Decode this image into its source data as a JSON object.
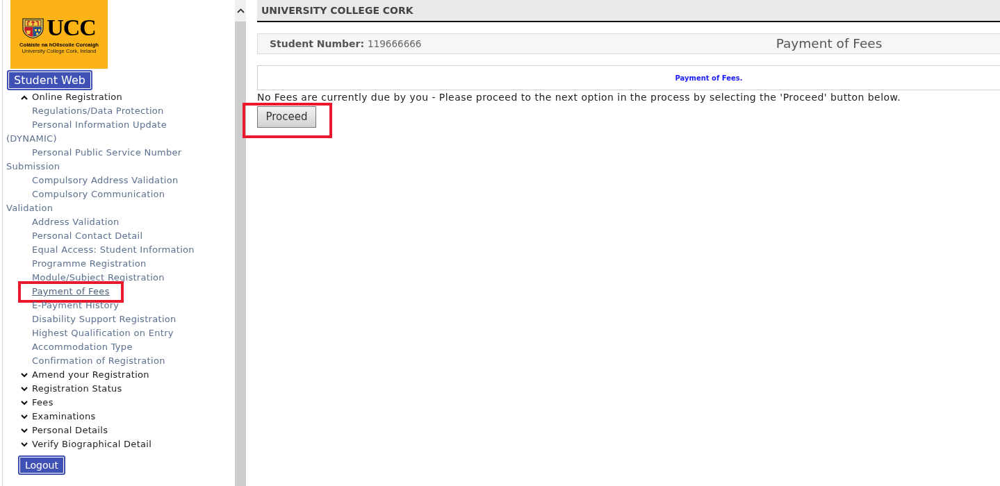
{
  "logo": {
    "name": "UCC",
    "irish_name": "Coláiste na hOllscoile Corcaigh",
    "english_name": "University College Cork, Ireland"
  },
  "sidebar": {
    "title_button": "Student Web",
    "menu": [
      {
        "label": "Online Registration",
        "expanded": true,
        "children": [
          {
            "label": "Regulations/Data Protection",
            "selected": false,
            "highlighted": false
          },
          {
            "label": "Personal Information Update (DYNAMIC)",
            "selected": false,
            "highlighted": false
          },
          {
            "label": "Personal Public Service Number Submission",
            "selected": false,
            "highlighted": false
          },
          {
            "label": "Compulsory Address Validation",
            "selected": false,
            "highlighted": false
          },
          {
            "label": "Compulsory Communication Validation",
            "selected": false,
            "highlighted": false
          },
          {
            "label": "Address Validation",
            "selected": false,
            "highlighted": false
          },
          {
            "label": "Personal Contact Detail",
            "selected": false,
            "highlighted": false
          },
          {
            "label": "Equal Access: Student Information",
            "selected": false,
            "highlighted": false
          },
          {
            "label": "Programme Registration",
            "selected": false,
            "highlighted": false
          },
          {
            "label": "Module/Subject Registration",
            "selected": false,
            "highlighted": false
          },
          {
            "label": "Payment of Fees",
            "selected": true,
            "highlighted": true
          },
          {
            "label": "E-Payment History",
            "selected": false,
            "highlighted": false
          },
          {
            "label": "Disability Support Registration",
            "selected": false,
            "highlighted": false
          },
          {
            "label": "Highest Qualification on Entry",
            "selected": false,
            "highlighted": false
          },
          {
            "label": "Accommodation Type",
            "selected": false,
            "highlighted": false
          },
          {
            "label": "Confirmation of Registration",
            "selected": false,
            "highlighted": false
          }
        ]
      },
      {
        "label": "Amend your Registration",
        "expanded": false
      },
      {
        "label": "Registration Status",
        "expanded": false
      },
      {
        "label": "Fees",
        "expanded": false
      },
      {
        "label": "Examinations",
        "expanded": false
      },
      {
        "label": "Personal Details",
        "expanded": false
      },
      {
        "label": "Verify Biographical Detail",
        "expanded": false
      }
    ],
    "logout_button": "Logout"
  },
  "header": {
    "title": "UNIVERSITY COLLEGE CORK"
  },
  "info_bar": {
    "label": "Student Number:",
    "value": "119666666",
    "page_title": "Payment of Fees"
  },
  "notice": {
    "title": "Payment of Fees."
  },
  "message": "No Fees are currently due by you - Please proceed to the next option in the process by selecting the 'Proceed' button below.",
  "proceed_button": {
    "label": "Proceed",
    "highlighted": true
  }
}
